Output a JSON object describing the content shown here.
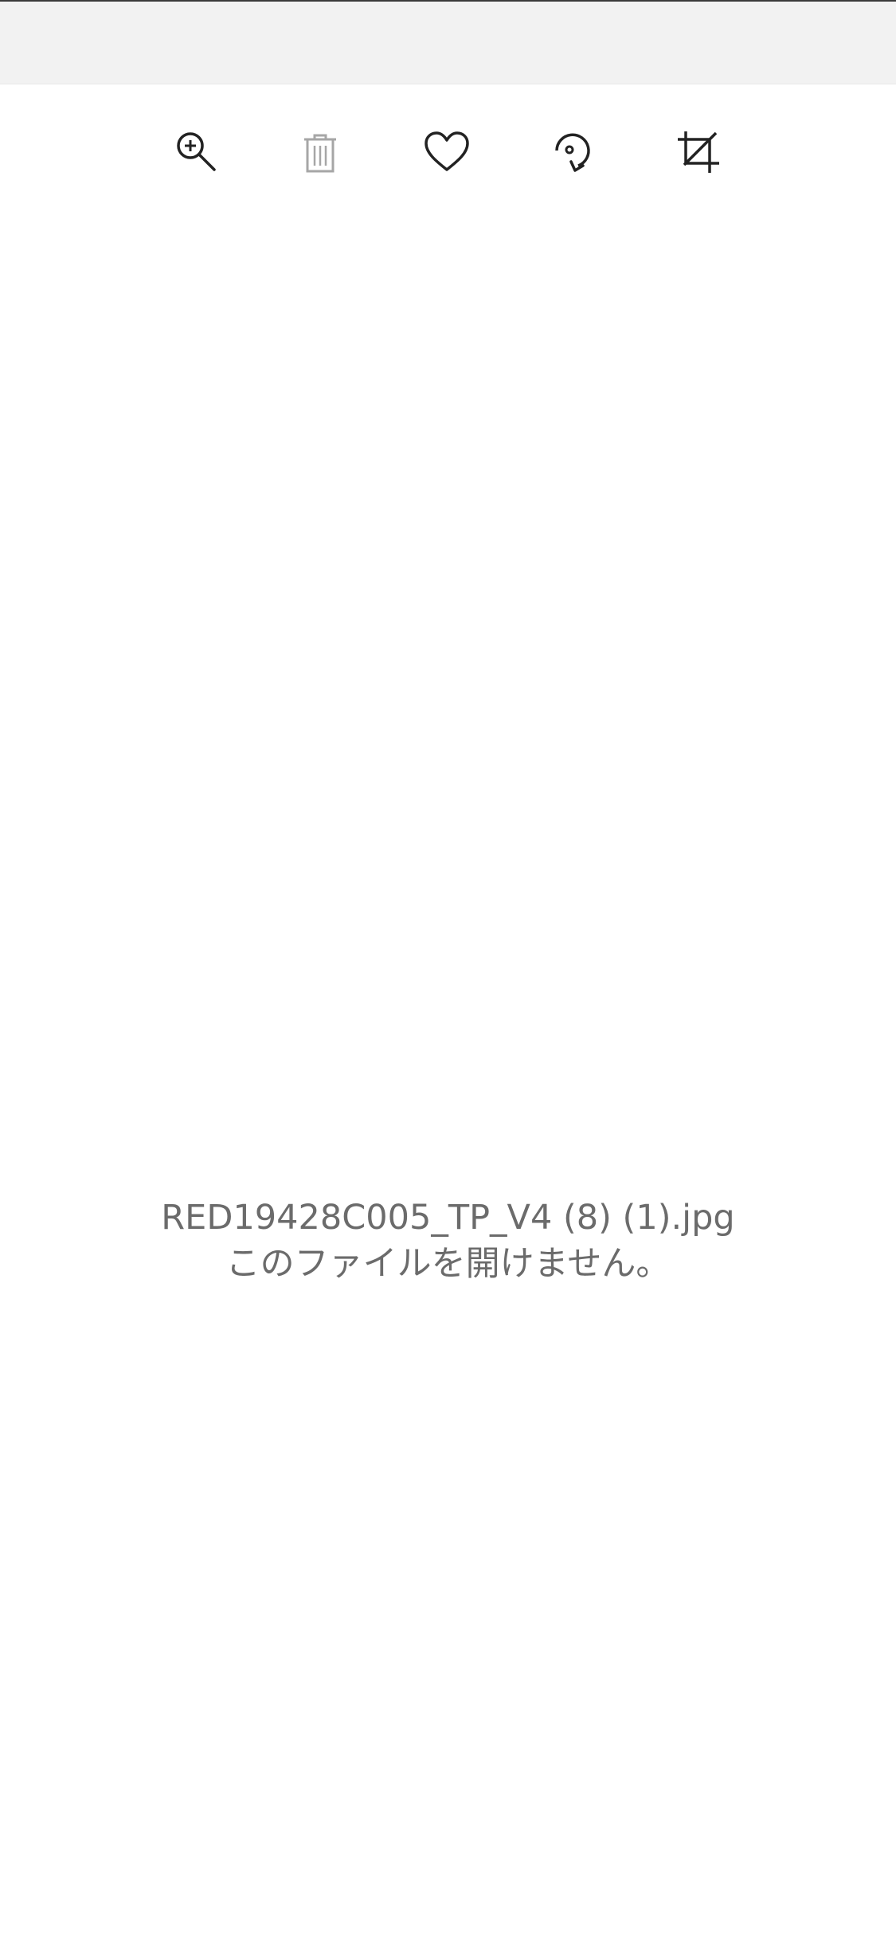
{
  "toolbar": {
    "buttons": [
      {
        "icon": "zoom-in-icon",
        "enabled": true
      },
      {
        "icon": "delete-icon",
        "enabled": false
      },
      {
        "icon": "favorite-icon",
        "enabled": true
      },
      {
        "icon": "rotate-icon",
        "enabled": true
      },
      {
        "icon": "crop-icon",
        "enabled": true
      }
    ]
  },
  "viewer": {
    "file_name": "RED19428C005_TP_V4 (8) (1).jpg",
    "error_message": "このファイルを開けません。"
  },
  "colors": {
    "icon": "#222222",
    "icon_disabled": "#a6a6a6",
    "message_text": "#6b6b6b",
    "title_bar_background": "#f2f2f2"
  }
}
